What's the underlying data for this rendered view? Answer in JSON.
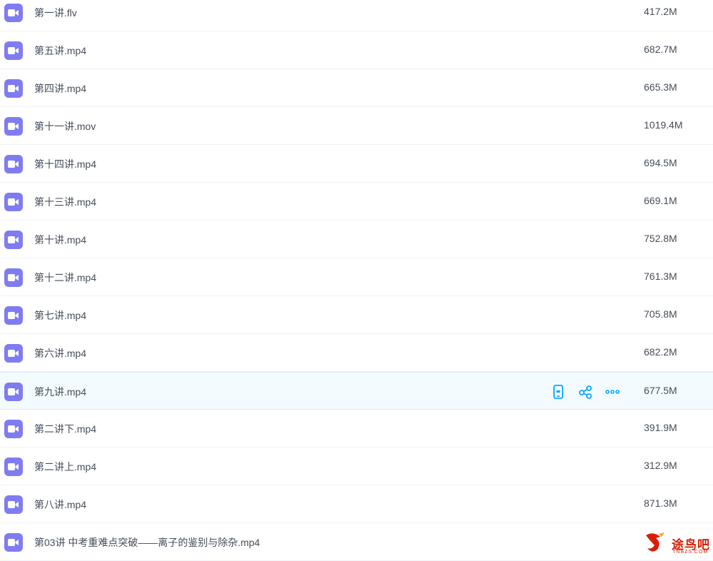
{
  "files": [
    {
      "name": "第一讲.flv",
      "size": "417.2M"
    },
    {
      "name": "第五讲.mp4",
      "size": "682.7M"
    },
    {
      "name": "第四讲.mp4",
      "size": "665.3M"
    },
    {
      "name": "第十一讲.mov",
      "size": "1019.4M"
    },
    {
      "name": "第十四讲.mp4",
      "size": "694.5M"
    },
    {
      "name": "第十三讲.mp4",
      "size": "669.1M"
    },
    {
      "name": "第十讲.mp4",
      "size": "752.8M"
    },
    {
      "name": "第十二讲.mp4",
      "size": "761.3M"
    },
    {
      "name": "第七讲.mp4",
      "size": "705.8M"
    },
    {
      "name": "第六讲.mp4",
      "size": "682.2M"
    },
    {
      "name": "第九讲.mp4",
      "size": "677.5M",
      "hovered": true
    },
    {
      "name": "第二讲下.mp4",
      "size": "391.9M"
    },
    {
      "name": "第二讲上.mp4",
      "size": "312.9M"
    },
    {
      "name": "第八讲.mp4",
      "size": "871.3M"
    },
    {
      "name": "第03讲 中考重难点突破——离子的鉴别与除杂.mp4",
      "size": ""
    }
  ],
  "row_actions": [
    {
      "icon": "phone-icon",
      "color": "#06a7ff"
    },
    {
      "icon": "share-icon",
      "color": "#06a7ff"
    },
    {
      "icon": "more-icon",
      "color": "#06a7ff"
    }
  ],
  "colors": {
    "file_icon": "#7f7cf2",
    "hover_row": "#f4fbff",
    "accent": "#06a7ff"
  },
  "watermark": {
    "text": "途鸟吧",
    "sub": "TNBZS.COM"
  }
}
